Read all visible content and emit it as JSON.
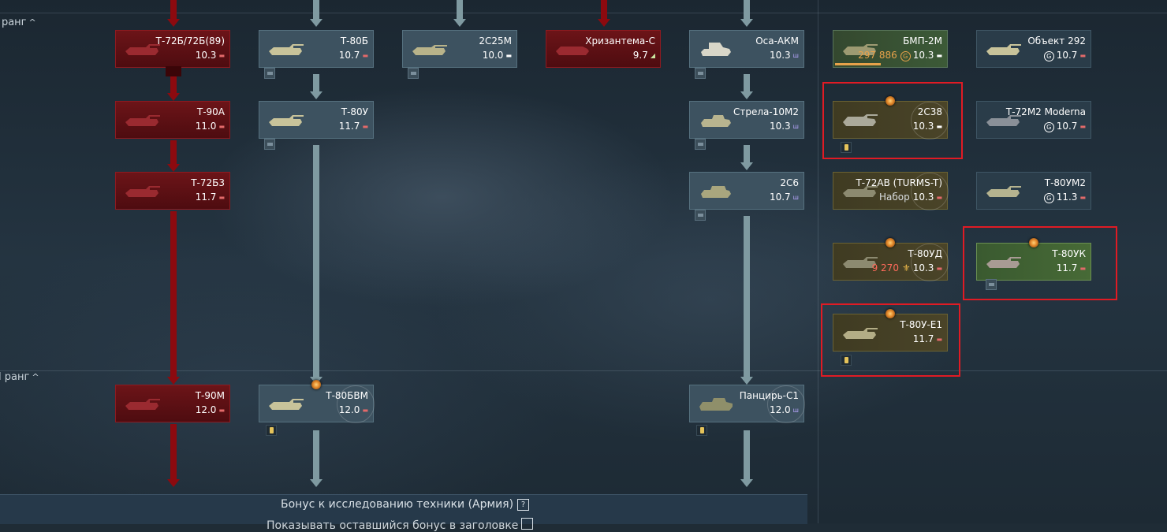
{
  "ranks": [
    {
      "label": "I ранг"
    },
    {
      "label": "II ранг"
    }
  ],
  "icons": {
    "rank_toggle": "chevron-up-icon",
    "light_tank": "diamond-icon",
    "medium_tank": "rectangle-icon",
    "heavy_tank": "bars-icon",
    "spaa": "spaa-icon",
    "tank_destroyer": "triangle-icon"
  },
  "symbols": {
    "chevron": "^",
    "medium": "▬",
    "light": "▬",
    "spaa": "ш",
    "td": "◢",
    "eagle": "⚜",
    "token": "G",
    "help": "?"
  },
  "vehicles": [
    {
      "name": "Т-72Б/72Б(89)",
      "br": "10.3",
      "type": "medium"
    },
    {
      "name": "Т-80Б",
      "br": "10.7",
      "type": "medium"
    },
    {
      "name": "2С25М",
      "br": "10.0",
      "type": "light"
    },
    {
      "name": "Хризантема-С",
      "br": "9.7",
      "type": "td"
    },
    {
      "name": "Оса-АКМ",
      "br": "10.3",
      "type": "spaa"
    },
    {
      "name": "БМП-2М",
      "br": "10.3",
      "type": "light",
      "extra": "297 886"
    },
    {
      "name": "Объект 292",
      "br": "10.7",
      "type": "medium"
    },
    {
      "name": "Т-90А",
      "br": "11.0",
      "type": "medium"
    },
    {
      "name": "Т-80У",
      "br": "11.7",
      "type": "medium"
    },
    {
      "name": "Стрела-10М2",
      "br": "10.3",
      "type": "spaa"
    },
    {
      "name": "2С38",
      "br": "10.3",
      "type": "light"
    },
    {
      "name": "Т-72М2 Moderna",
      "br": "10.7",
      "type": "medium"
    },
    {
      "name": "Т-72Б3",
      "br": "11.7",
      "type": "medium"
    },
    {
      "name": "2С6",
      "br": "10.7",
      "type": "spaa"
    },
    {
      "name": "Т-72АВ (TURMS-T)",
      "br": "10.3",
      "type": "medium",
      "extra": "Набор"
    },
    {
      "name": "Т-80УМ2",
      "br": "11.3",
      "type": "medium"
    },
    {
      "name": "Т-80УД",
      "br": "10.3",
      "type": "medium",
      "extra": "9 270"
    },
    {
      "name": "Т-80УК",
      "br": "11.7",
      "type": "medium"
    },
    {
      "name": "Т-80У-Е1",
      "br": "11.7",
      "type": "medium"
    },
    {
      "name": "Т-90М",
      "br": "12.0",
      "type": "medium"
    },
    {
      "name": "Т-80БВМ",
      "br": "12.0",
      "type": "medium"
    },
    {
      "name": "Панцирь-С1",
      "br": "12.0",
      "type": "spaa"
    }
  ],
  "footer": {
    "bonus_label": "Бонус к исследованию техники (Армия)",
    "help_symbol": "?",
    "toggle_label": "Показывать оставшийся бонус в заголовке"
  },
  "colors": {
    "researched_red": "#8c0a0f",
    "line_grey": "#7f9aa1",
    "card_default": "#3d5260",
    "highlight": "#e01b24",
    "premium_gold": "#e3882a"
  }
}
